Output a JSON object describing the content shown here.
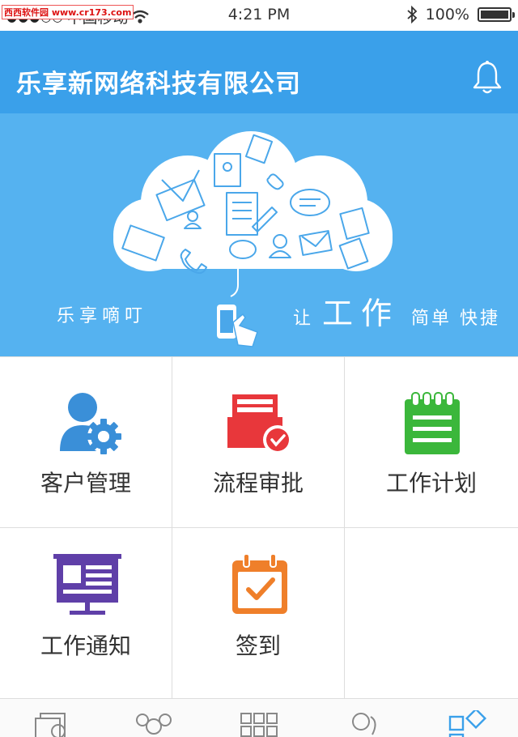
{
  "status_bar": {
    "watermark": "西西软件园 www.cr173.com",
    "signal_dots": "●●●○○",
    "carrier": "中国移动",
    "time": "4:21 PM",
    "battery_percent": "100%",
    "battery_level": 1.0
  },
  "header": {
    "title": "乐享新网络科技有限公司",
    "bell_icon": "bell-icon"
  },
  "banner": {
    "slogan_left": "乐享嘀叮",
    "slogan_right_1": "让",
    "slogan_right_2": "工作",
    "slogan_right_3": "简单 快捷"
  },
  "grid": [
    {
      "label": "客户管理",
      "icon": "customer-gear-icon",
      "color": "#3a8fd8"
    },
    {
      "label": "流程审批",
      "icon": "approval-tray-icon",
      "color": "#e8373b"
    },
    {
      "label": "工作计划",
      "icon": "notepad-icon",
      "color": "#3bb73b"
    },
    {
      "label": "工作通知",
      "icon": "notice-board-icon",
      "color": "#5f3fa8"
    },
    {
      "label": "签到",
      "icon": "calendar-check-icon",
      "color": "#ef7f2a"
    }
  ],
  "tabbar": {
    "tabs": [
      "messages-icon",
      "contacts-icon",
      "apps-grid-icon",
      "people-icon",
      "workspace-icon"
    ],
    "active_index": 4,
    "active_color": "#3aa0ea"
  }
}
